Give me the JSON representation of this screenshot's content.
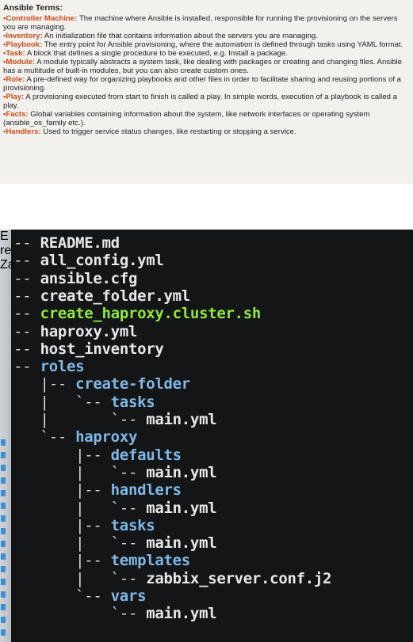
{
  "terms_section": {
    "heading": "Ansible Terms:",
    "items": [
      {
        "key": "•Controller Machine:",
        "text": " The machine where Ansible is installed, responsible for running the provisioning on the servers you are managing."
      },
      {
        "key": "•Inventory:",
        "text": " An initialization file that contains information about the servers you are managing."
      },
      {
        "key": "•Playbook:",
        "text": " The entry point for Ansible provisioning, where the automation is defined through tasks using YAML format."
      },
      {
        "key": "•Task:",
        "text": " A block that defines a single procedure to be executed, e.g. Install a package."
      },
      {
        "key": "•Module:",
        "text": " A module typically abstracts a system task, like dealing with packages or creating and changing files. Ansible has a multitude of built-in modules, but you can also create custom ones."
      },
      {
        "key": "•Role:",
        "text": " A pre-defined way for organizing playbooks and other files in order to facilitate sharing and reusing portions of a provisioning."
      },
      {
        "key": "•Play:",
        "text": " A provisioning executed from start to finish is called a play. In simple words, execution of a playbook is called a play."
      },
      {
        "key": "•Facts:",
        "text": " Global variables containing information about the system, like network interfaces or operating system (ansible_os_family etc.)."
      },
      {
        "key": "•Handlers:",
        "text": " Used to trigger service status changes, like restarting or stopping a service."
      }
    ]
  },
  "terminal": {
    "lines": [
      {
        "prefix": "|-- ",
        "name": "README.md",
        "kind": "file"
      },
      {
        "prefix": "|-- ",
        "name": "all_config.yml",
        "kind": "file"
      },
      {
        "prefix": "|-- ",
        "name": "ansible.cfg",
        "kind": "file"
      },
      {
        "prefix": "|-- ",
        "name": "create_folder.yml",
        "kind": "file"
      },
      {
        "prefix": "|-- ",
        "name": "create_haproxy.cluster.sh",
        "kind": "green"
      },
      {
        "prefix": "|-- ",
        "name": "haproxy.yml",
        "kind": "file"
      },
      {
        "prefix": "|-- ",
        "name": "host_inventory",
        "kind": "file"
      },
      {
        "prefix": "`-- ",
        "name": "roles",
        "kind": "dir"
      },
      {
        "prefix": "    |-- ",
        "name": "create-folder",
        "kind": "dir"
      },
      {
        "prefix": "    |   `-- ",
        "name": "tasks",
        "kind": "dir"
      },
      {
        "prefix": "    |       `-- ",
        "name": "main.yml",
        "kind": "file"
      },
      {
        "prefix": "    `-- ",
        "name": "haproxy",
        "kind": "dir"
      },
      {
        "prefix": "        |-- ",
        "name": "defaults",
        "kind": "dir"
      },
      {
        "prefix": "        |   `-- ",
        "name": "main.yml",
        "kind": "file"
      },
      {
        "prefix": "        |-- ",
        "name": "handlers",
        "kind": "dir"
      },
      {
        "prefix": "        |   `-- ",
        "name": "main.yml",
        "kind": "file"
      },
      {
        "prefix": "        |-- ",
        "name": "tasks",
        "kind": "dir"
      },
      {
        "prefix": "        |   `-- ",
        "name": "main.yml",
        "kind": "file"
      },
      {
        "prefix": "        |-- ",
        "name": "templates",
        "kind": "dir"
      },
      {
        "prefix": "        |   `-- ",
        "name": "zabbix_server.conf.j2",
        "kind": "file"
      },
      {
        "prefix": "        `-- ",
        "name": "vars",
        "kind": "dir"
      },
      {
        "prefix": "            `-- ",
        "name": "main.yml",
        "kind": "file"
      }
    ]
  },
  "margin_glyphs": [
    "E",
    "re",
    "Za"
  ]
}
